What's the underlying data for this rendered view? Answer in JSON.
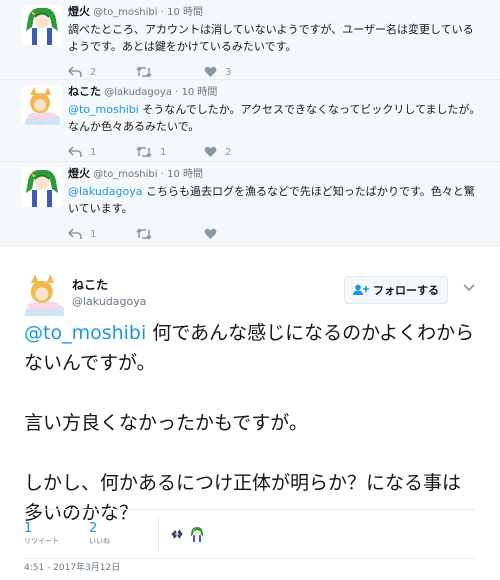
{
  "replies": [
    {
      "name": "燈火",
      "handle": "@to_moshibi",
      "sep": "·",
      "time": "10 時間",
      "mention": "",
      "text": "調べたところ、アカウントは消していないようですが、ユーザー名は変更しているようです。あとは鍵をかけているみたいです。",
      "reply_count": "2",
      "retweet_count": "",
      "like_count": "3",
      "avatar_icon": "green-haired-girl-avatar"
    },
    {
      "name": "ねこた",
      "handle": "@lakudagoya",
      "sep": "·",
      "time": "10 時間",
      "mention": "@to_moshibi",
      "text": " そうなんでしたか。アクセスできなくなってビックリしてましたが。なんか色々あるみたいで。",
      "reply_count": "1",
      "retweet_count": "1",
      "like_count": "2",
      "avatar_icon": "cat-girl-avatar"
    },
    {
      "name": "燈火",
      "handle": "@to_moshibi",
      "sep": "·",
      "time": "10 時間",
      "mention": "@lakudagoya",
      "text": " こちらも過去ログを漁るなどで先ほど知ったばかりです。色々と驚いています。",
      "reply_count": "1",
      "retweet_count": "",
      "like_count": "",
      "avatar_icon": "green-haired-girl-avatar"
    }
  ],
  "main": {
    "name": "ねこた",
    "handle": "@lakudagoya",
    "follow_label": "フォローする",
    "mention": "@to_moshibi",
    "text": " 何であんな感じになるのかよくわからないんですが。\n\n言い方良くなかったかもですが。\n\nしかし、何かあるにつけ正体が明らか？になる事は多いのかな？",
    "retweets": {
      "count": "1",
      "label": "リツイート"
    },
    "likes": {
      "count": "2",
      "label": "いいね"
    },
    "timestamp": "4:51 - 2017年3月12日"
  },
  "colors": {
    "accent": "#1b95e0",
    "muted": "#8899a6",
    "thread_bg": "#f5f8fa"
  }
}
